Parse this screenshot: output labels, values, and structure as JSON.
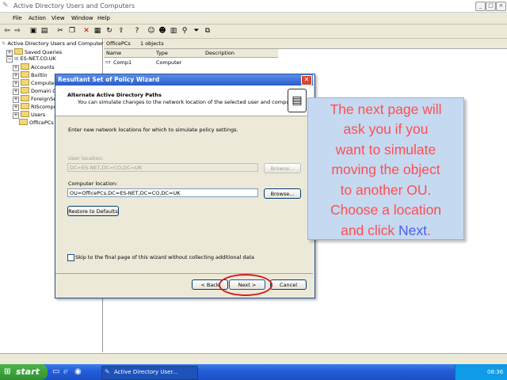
{
  "window": {
    "title": "Active Directory Users and Computers",
    "controls": [
      "_",
      "□",
      "×"
    ]
  },
  "menu": [
    "File",
    "Action",
    "View",
    "Window",
    "Help"
  ],
  "tree": {
    "root": "Active Directory Users and Computers",
    "items": [
      {
        "label": "Saved Queries"
      },
      {
        "label": "ES-NET.CO.UK"
      },
      {
        "label": "Accounts"
      },
      {
        "label": "Builtin"
      },
      {
        "label": "Computers"
      },
      {
        "label": "Domain Co"
      },
      {
        "label": "ForeignSe"
      },
      {
        "label": "RIScomput"
      },
      {
        "label": "Users"
      },
      {
        "label": "OfficePCs"
      }
    ]
  },
  "right_pane": {
    "tab_title": "OfficePCs",
    "object_count": "1 objects",
    "columns": [
      "Name",
      "Type",
      "Description"
    ],
    "rows": [
      {
        "name": "Comp1",
        "type": "Computer",
        "description": ""
      }
    ]
  },
  "dialog": {
    "title": "Resultant Set of Policy Wizard",
    "heading": "Alternate Active Directory Paths",
    "subheading": "You can simulate changes to the network location of the selected user and computer.",
    "instruction": "Enter new network locations for which to simulate policy settings.",
    "user_location_label": "User location:",
    "user_location_value": "DC=ES-NET,DC=CO,DC=UK",
    "computer_location_label": "Computer location:",
    "computer_location_value": "OU=OfficePCs,DC=ES-NET,DC=CO,DC=UK",
    "browse_label": "Browse...",
    "restore_label": "Restore to Defaults",
    "skip_label": "Skip to the final page of this wizard without collecting additional data",
    "back_label": "< Back",
    "next_label": "Next >",
    "cancel_label": "Cancel"
  },
  "callout": {
    "lines": [
      "The next page will",
      "ask you if you",
      "want to simulate",
      "moving the object",
      "to another OU.",
      "Choose a location"
    ],
    "last_line_prefix": "and click ",
    "last_line_highlight": "Next",
    "last_line_suffix": ".",
    "text_color": "#ff4f4f",
    "highlight_color": "#4a5ee8"
  },
  "taskbar": {
    "start_label": "start",
    "task_label": "Active Directory User...",
    "language": "EN",
    "clock": "08:36"
  }
}
